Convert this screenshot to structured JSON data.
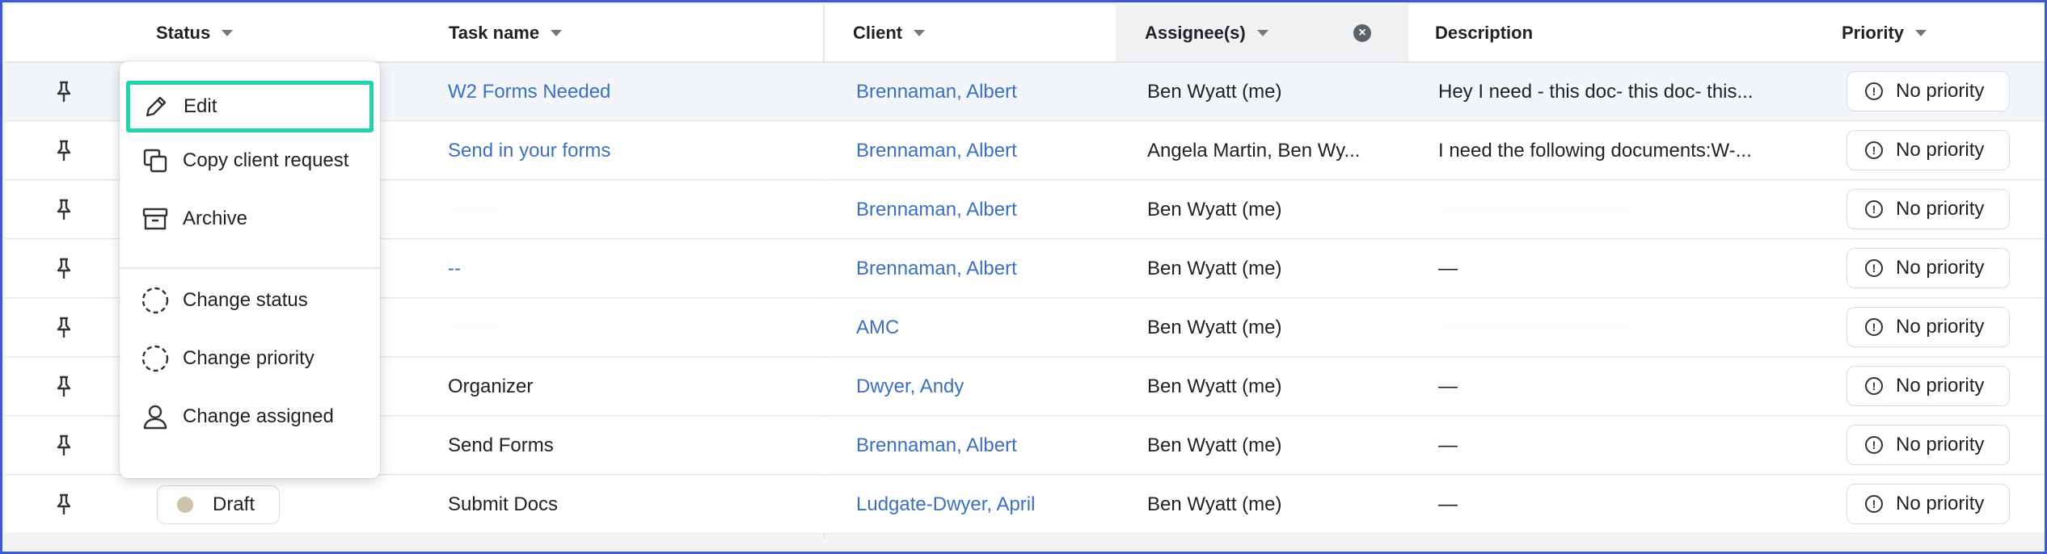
{
  "headers": {
    "status": "Status",
    "task_name": "Task name",
    "client": "Client",
    "assignees": "Assignee(s)",
    "description": "Description",
    "priority": "Priority"
  },
  "rows": [
    {
      "task": "W2 Forms Needed",
      "client": "Brennaman, Albert",
      "assignee": "Ben Wyatt (me)",
      "description": "Hey I need - this doc- this doc- this...",
      "priority": "No priority"
    },
    {
      "task": "Send in your forms",
      "client": "Brennaman, Albert",
      "assignee": "Angela Martin, Ben Wy...",
      "description": "I need the following documents:W-...",
      "priority": "No priority"
    },
    {
      "task": "········",
      "client": "Brennaman, Albert",
      "assignee": "Ben Wyatt (me)",
      "description": "······························",
      "priority": "No priority"
    },
    {
      "task": "--",
      "client": "Brennaman, Albert",
      "assignee": "Ben Wyatt (me)",
      "description": "—",
      "priority": "No priority"
    },
    {
      "task": "········",
      "client": "AMC",
      "assignee": "Ben Wyatt (me)",
      "description": "······························",
      "priority": "No priority"
    },
    {
      "task": "Organizer",
      "client": "Dwyer, Andy",
      "assignee": "Ben Wyatt (me)",
      "description": "—",
      "priority": "No priority"
    },
    {
      "task": "Send Forms",
      "client": "Brennaman, Albert",
      "assignee": "Ben Wyatt (me)",
      "description": "—",
      "priority": "No priority"
    },
    {
      "task": "Submit Docs",
      "client": "Ludgate-Dwyer, April",
      "assignee": "Ben Wyatt (me)",
      "description": "—",
      "priority": "No priority",
      "status": "Draft"
    }
  ],
  "menu": {
    "edit": "Edit",
    "copy": "Copy client request",
    "archive": "Archive",
    "change_status": "Change status",
    "change_priority": "Change priority",
    "change_assigned": "Change assigned"
  },
  "icons": {
    "pin": "pin-icon",
    "priority": "alert-circle-icon",
    "clear": "clear-filter-icon"
  },
  "colors": {
    "link": "#3d6fc1",
    "focus_ring": "#22d3b0",
    "draft_dot": "#cfc2ad"
  }
}
